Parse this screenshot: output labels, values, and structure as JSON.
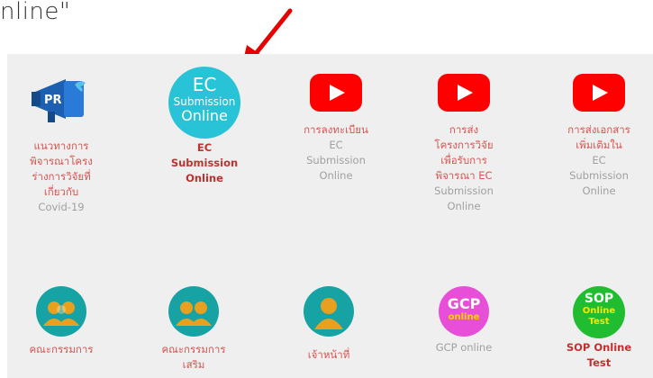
{
  "caption": "nline\"",
  "items": [
    {
      "lines": [
        "แนวทางการ",
        "พิจารณาโครง",
        "ร่างการวิจัยที่",
        "เกี่ยวกับ"
      ],
      "gray_lines": [
        "Covid-19"
      ]
    },
    {
      "icon_text": [
        "EC",
        "Submission",
        "Online"
      ],
      "lines": [
        "EC",
        "Submission",
        "Online"
      ]
    },
    {
      "lines": [
        "การลงทะเบียน"
      ],
      "gray_lines": [
        "EC",
        "Submission",
        "Online"
      ]
    },
    {
      "lines": [
        "การส่ง",
        "โครงการวิจัย",
        "เพื่อรับการ",
        "พิจารณา EC"
      ],
      "gray_lines": [
        "Submission",
        "Online"
      ]
    },
    {
      "lines": [
        "การส่งเอกสาร",
        "เพิ่มเติมใน"
      ],
      "gray_lines": [
        "EC",
        "Submission",
        "Online"
      ]
    },
    {
      "lines": [
        "คณะกรรมการ"
      ]
    },
    {
      "lines": [
        "คณะกรรมการ",
        "เสริม"
      ]
    },
    {
      "lines": [
        "เจ้าหน้าที่"
      ]
    },
    {
      "icon_text": [
        "GCP",
        "online"
      ],
      "lines": [
        "GCP online"
      ]
    },
    {
      "icon_text": [
        "SOP",
        "Online",
        "Test"
      ],
      "lines": [
        "SOP Online",
        "Test"
      ]
    }
  ],
  "colors": {
    "accent_red": "#e60000",
    "teal": "#17a3a4",
    "link": "#d9534f"
  }
}
